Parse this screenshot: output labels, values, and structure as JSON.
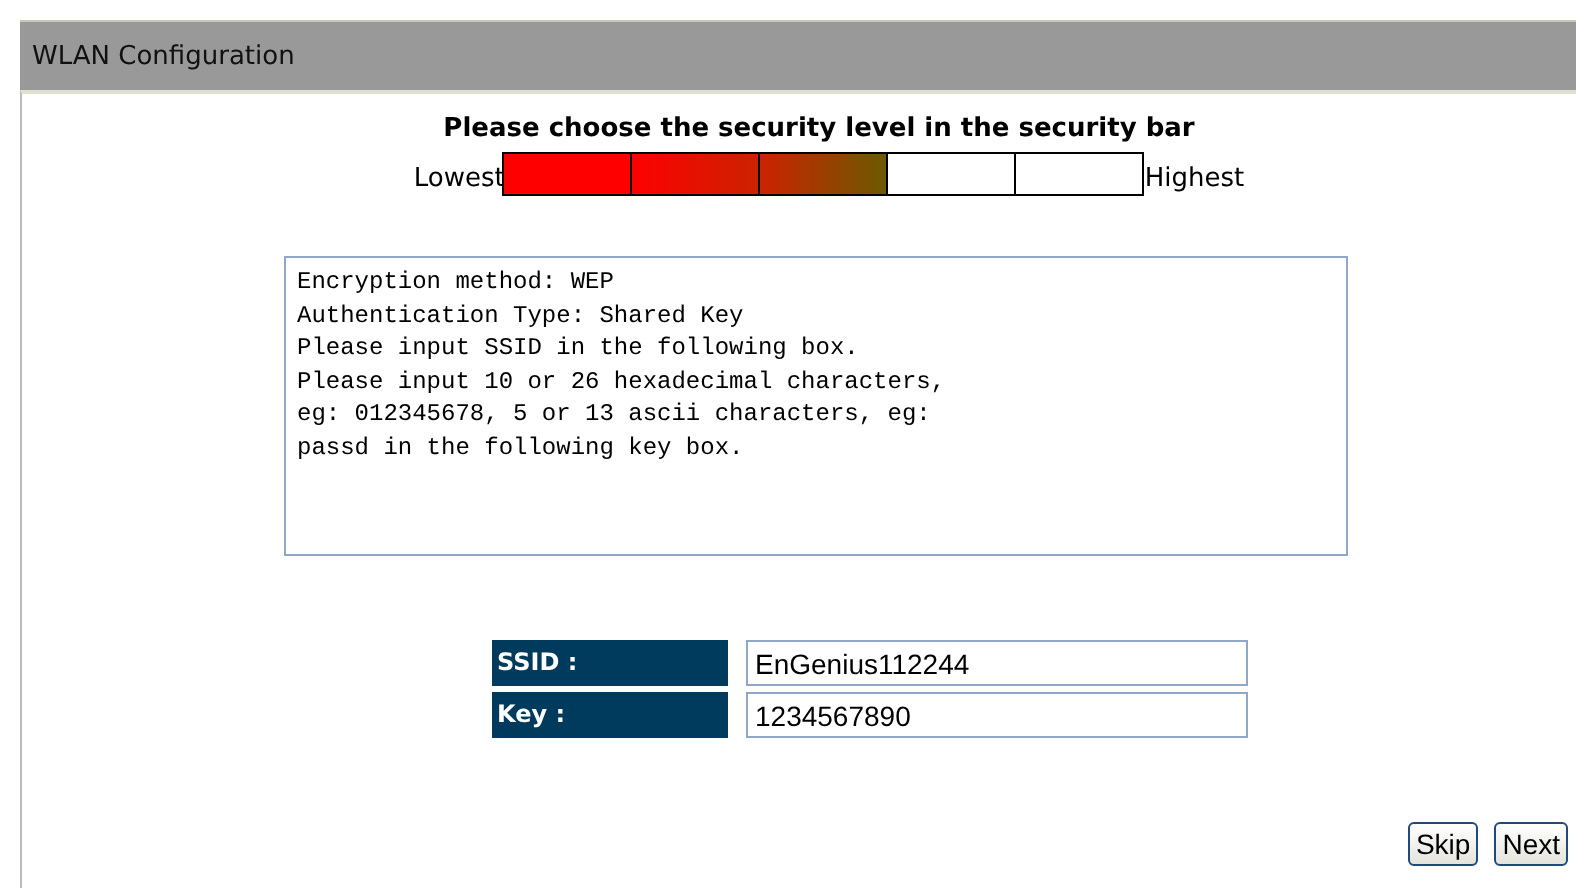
{
  "window": {
    "title": "WLAN Configuration"
  },
  "security": {
    "heading": "Please choose the security level in the security bar",
    "low_label": "Lowest",
    "high_label": "Highest",
    "segments": [
      {
        "color": "#ff0000",
        "selected": true
      },
      {
        "color": "#cc2200",
        "selected": true
      },
      {
        "color": "#6b5a00",
        "selected": true
      },
      {
        "selected": false
      },
      {
        "selected": false
      }
    ]
  },
  "info_text": "Encryption method: WEP\nAuthentication Type: Shared Key\nPlease input SSID in the following box.\nPlease input 10 or 26 hexadecimal characters,\neg: 012345678, 5 or 13 ascii characters, eg:\npassd in the following key box.",
  "fields": [
    {
      "label": "SSID :",
      "value": "EnGenius112244"
    },
    {
      "label": "Key :",
      "value": "1234567890"
    }
  ],
  "buttons": [
    "Skip",
    "Next"
  ]
}
